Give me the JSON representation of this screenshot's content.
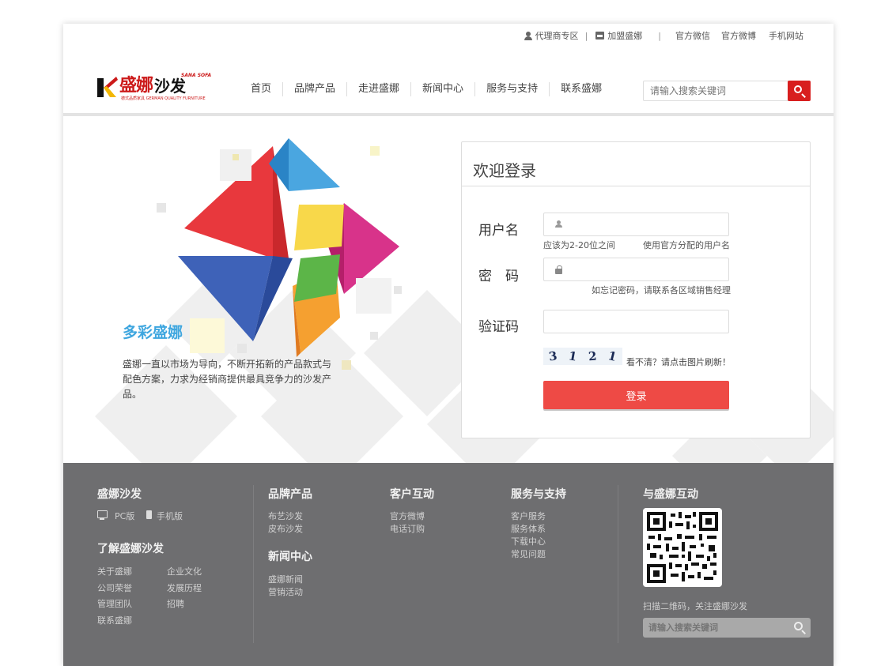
{
  "toplinks": {
    "agent": "代理商专区",
    "join": "加盟盛娜",
    "wechat": "官方微信",
    "weibo": "官方微博",
    "mobile": "手机网站",
    "sep1": "|",
    "sep2": "|"
  },
  "logo": {
    "name": "盛娜",
    "product": "沙发",
    "tag": "SANA SOFA",
    "sub": "德式品质家具 GERMAN QUALITY FURNITURE"
  },
  "nav": [
    "首页",
    "品牌产品",
    "走进盛娜",
    "新闻中心",
    "服务与支持",
    "联系盛娜"
  ],
  "search": {
    "placeholder": "请输入搜索关键词"
  },
  "hero": {
    "title": "多彩盛娜",
    "text": "盛娜一直以市场为导向，不断开拓新的产品款式与配色方案，力求为经销商提供最具竞争力的沙发产品。"
  },
  "login": {
    "title": "欢迎登录",
    "username_label": "用户名",
    "username_hint_left": "应该为2-20位之间",
    "username_hint_right": "使用官方分配的用户名",
    "password_label": "密　码",
    "password_hint": "如忘记密码，请联系各区域销售经理",
    "captcha_label": "验证码",
    "captcha_chars": [
      "3",
      "1",
      "2",
      "1"
    ],
    "captcha_refresh": "看不清？请点击图片刷新！",
    "submit": "登录"
  },
  "footer": {
    "brand_title": "盛娜沙发",
    "pc": "PC版",
    "mobile": "手机版",
    "about_title": "了解盛娜沙发",
    "about_links": [
      "关于盛娜",
      "企业文化",
      "公司荣誉",
      "发展历程",
      "管理团队",
      "招聘",
      "联系盛娜"
    ],
    "products_title": "品牌产品",
    "products_links": [
      "布艺沙发",
      "皮布沙发"
    ],
    "news_title": "新闻中心",
    "news_links": [
      "盛娜新闻",
      "营销活动"
    ],
    "interact_title": "客户互动",
    "interact_links": [
      "官方微博",
      "电话订购"
    ],
    "service_title": "服务与支持",
    "service_links": [
      "客户服务",
      "服务体系",
      "下载中心",
      "常见问题"
    ],
    "social_title": "与盛娜互动",
    "qr_caption": "扫描二维码，关注盛娜沙发",
    "search_placeholder": "请输入搜索关键词"
  },
  "colors": {
    "brand_red": "#d81e1e",
    "login_button": "#ee4a45",
    "hero_title": "#3ea6df",
    "footer_bg": "#6e6e70"
  }
}
